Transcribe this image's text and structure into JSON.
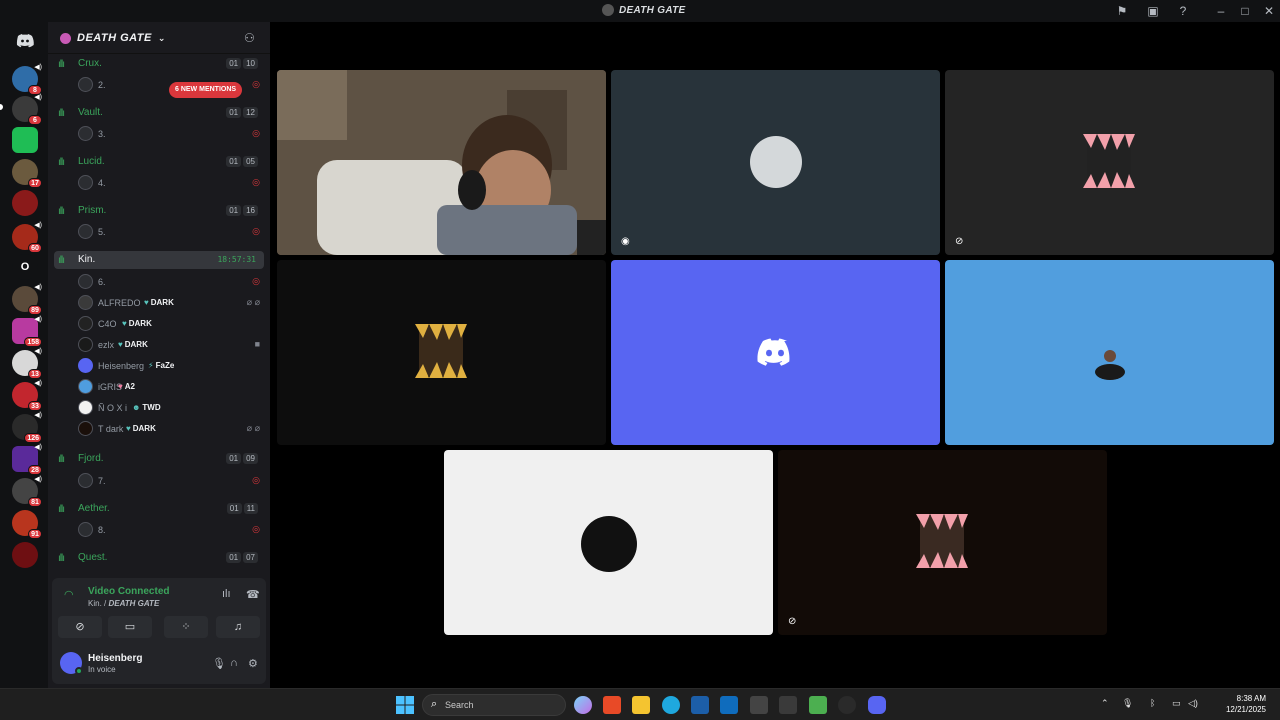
{
  "window": {
    "title": "DEATH GATE"
  },
  "guild": {
    "name": "DEATH GATE",
    "mentions_pill": "6 NEW MENTIONS"
  },
  "rail_badges": [
    "8",
    "6",
    "17",
    "60",
    "89",
    "158",
    "13",
    "33",
    "126",
    "28",
    "81",
    "91"
  ],
  "channels": [
    {
      "name": "Crux.",
      "sub": "2.",
      "count": [
        "01",
        "10"
      ]
    },
    {
      "name": "Vault.",
      "sub": "3.",
      "count": [
        "01",
        "12"
      ]
    },
    {
      "name": "Lucid.",
      "sub": "4.",
      "count": [
        "01",
        "05"
      ]
    },
    {
      "name": "Prism.",
      "sub": "5.",
      "count": [
        "01",
        "16"
      ]
    },
    {
      "name": "Kin.",
      "sub": "6.",
      "timer": "18:57:31"
    },
    {
      "name": "Fjord.",
      "sub": "7.",
      "count": [
        "01",
        "09"
      ]
    },
    {
      "name": "Aether.",
      "sub": "8.",
      "count": [
        "01",
        "11"
      ]
    },
    {
      "name": "Quest.",
      "count": [
        "01",
        "07"
      ]
    }
  ],
  "members": [
    {
      "name": "ALFREDO",
      "tag": "DARK"
    },
    {
      "name": "C4O",
      "tag": "DARK"
    },
    {
      "name": "ezlx",
      "tag": "DARK"
    },
    {
      "name": "Heisenberg",
      "tag": "FaZe"
    },
    {
      "name": "iGRIS",
      "tag": "A2"
    },
    {
      "name": "Ñ O X i",
      "tag": "TWD"
    },
    {
      "name": "T dark",
      "tag": "DARK"
    }
  ],
  "voice": {
    "status": "Video Connected",
    "channel": "Kin.",
    "guild": "DEATH GATE"
  },
  "user": {
    "name": "Heisenberg",
    "status": "In voice"
  },
  "taskbar": {
    "search_placeholder": "Search",
    "time": "8:38 AM",
    "date": "12/21/2025"
  },
  "colors": {
    "blurple": "#5865f2",
    "sky": "#4f9ddf",
    "online": "#23a55a",
    "mention": "#da373c"
  }
}
